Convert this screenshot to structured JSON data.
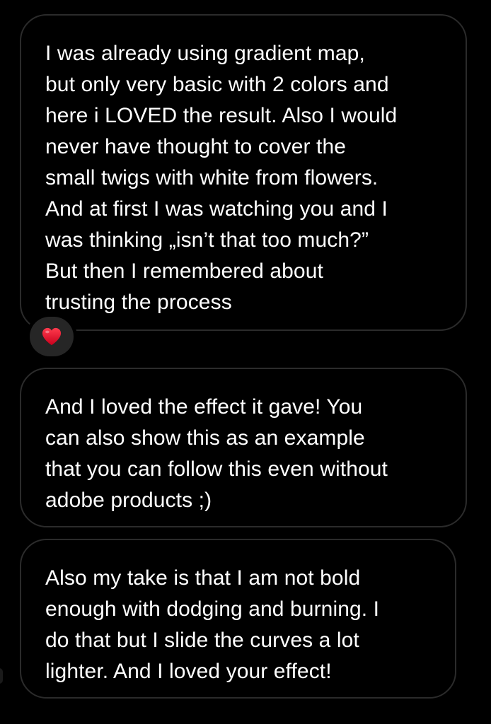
{
  "messages": [
    {
      "text": "I was already using gradient map,\nbut only very basic with 2 colors and\nhere i LOVED the result. Also I would\nnever have thought to cover the\nsmall twigs with white from flowers.\nAnd at first I was watching you and I\nwas thinking „isn’t that too much?”\nBut then I remembered about\ntrusting the process",
      "reaction": "heart-emoji"
    },
    {
      "text": "And I loved the effect it gave! You\ncan also show this as an example\nthat you can follow this even without\nadobe products ;)"
    },
    {
      "text": "Also my take is that I am not bold\nenough with dodging and burning. I\ndo that but I slide the curves a lot\nlighter. And I loved your effect!"
    }
  ],
  "colors": {
    "background": "#000000",
    "bubble_border": "#2b2b2b",
    "text": "#ffffff",
    "reaction_bg": "#262626",
    "heart": "#e0102a"
  },
  "icons": {
    "reaction": "heart-icon"
  }
}
